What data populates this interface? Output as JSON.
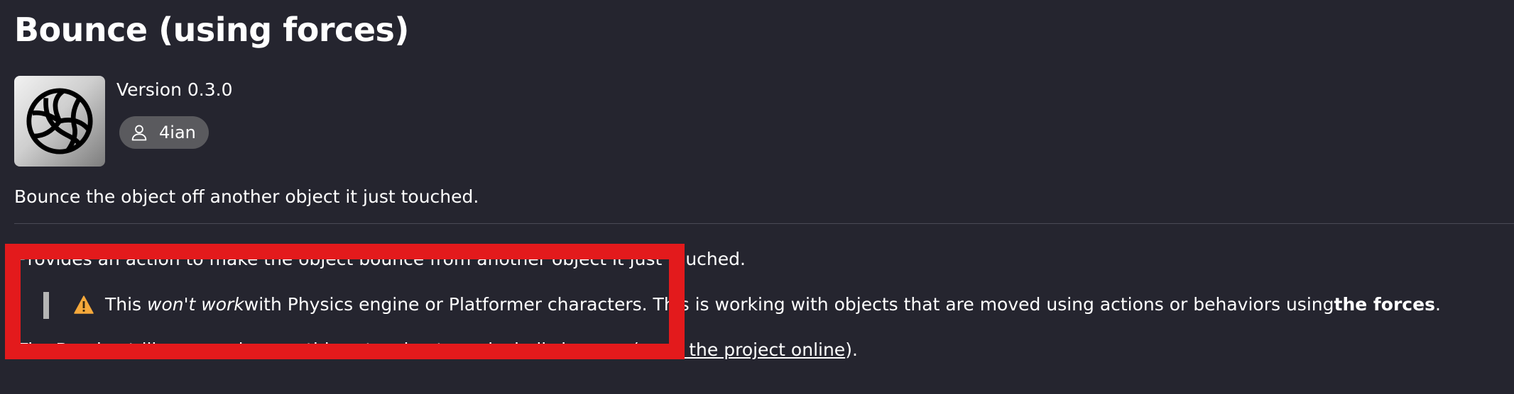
{
  "extension": {
    "title": "Bounce (using forces)",
    "version": "Version 0.3.0",
    "author": "4ian",
    "icon": "volleyball-icon",
    "short_description": "Bounce the object off another object it just touched."
  },
  "description": {
    "para1": "Provides an action to make the object bounce from another object it just touched.",
    "quote": {
      "icon": "warning-icon",
      "pre": "This ",
      "emph": "won't work",
      "mid": " with Physics engine or Platformer characters. This is working with objects that are moved using actions or behaviors using ",
      "strong": "the forces",
      "post": "."
    },
    "para3": {
      "pre": "The Breakout-like example uses this extension to make balls bounce (",
      "link": "open the project online",
      "post": ")."
    }
  },
  "colors": {
    "background": "#25252f",
    "text": "#ffffff",
    "chip": "#5a5a5e",
    "highlight": "#e31a1c",
    "warning": "#f6a93b"
  }
}
